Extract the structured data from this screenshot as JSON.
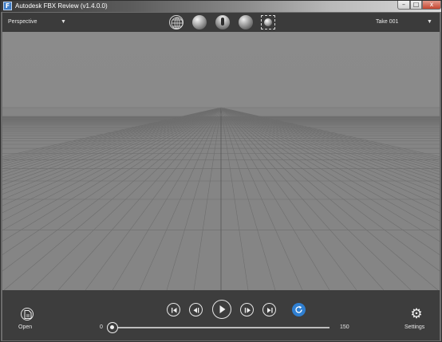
{
  "window": {
    "title": "Autodesk FBX Review (v1.4.0.0)",
    "controls": {
      "minimize": "–",
      "maximize": "□",
      "close": "x"
    }
  },
  "toolbar": {
    "camera": {
      "value": "Perspective",
      "icon": "chevron-down-icon"
    },
    "take": {
      "value": "Take 001",
      "icon": "chevron-down-icon"
    },
    "shading_modes": [
      {
        "name": "wireframe",
        "icon": "wireframe-globe-icon"
      },
      {
        "name": "shaded",
        "icon": "shaded-sphere-icon"
      },
      {
        "name": "lit",
        "icon": "light-bulb-sphere-icon"
      },
      {
        "name": "textured",
        "icon": "textured-sphere-icon"
      },
      {
        "name": "frame-all",
        "icon": "frame-selection-icon"
      }
    ]
  },
  "viewport": {
    "background_top": "#8b8b8b",
    "grid_color": "#6e6e6e",
    "axis_color": "#5a5a5a"
  },
  "playback": {
    "open_label": "Open",
    "settings_label": "Settings",
    "buttons": [
      "go-to-start",
      "step-back",
      "play",
      "step-forward",
      "go-to-end",
      "loop"
    ],
    "loop_active_color": "#2f7fd1",
    "range_start": "0",
    "range_end": "150",
    "current_frame": 0
  }
}
